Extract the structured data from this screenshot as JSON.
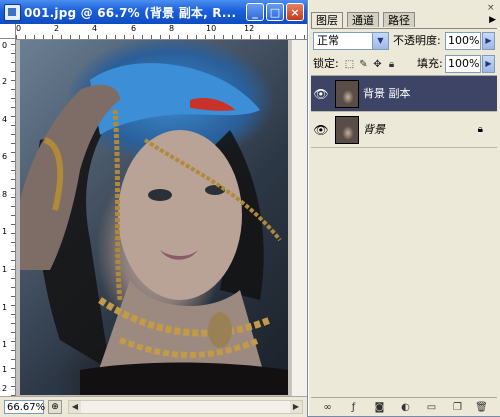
{
  "document": {
    "title": "001.jpg @ 66.7% (背景 副本, R...",
    "window_buttons": {
      "minimize": "_",
      "maximize": "□",
      "close": "×"
    },
    "ruler_top_labels": [
      "0",
      "2",
      "4",
      "6",
      "8",
      "10",
      "12"
    ],
    "ruler_left_labels": [
      "0",
      "2",
      "4",
      "6",
      "8",
      "1",
      "1",
      "1",
      "1",
      "1",
      "2"
    ],
    "zoom": "66.67%",
    "status_icon": "⊕",
    "image_description_icon": "portrait-photo"
  },
  "layers_panel": {
    "close": "×",
    "tabs": [
      "图层",
      "通道",
      "路径"
    ],
    "active_tab": 0,
    "menu_arrow": "▶",
    "blend_mode": "正常",
    "opacity_label": "不透明度:",
    "opacity_value": "100%",
    "lock_label": "锁定:",
    "fill_label": "填充:",
    "fill_value": "100%",
    "arrow": "▶",
    "dropdown_arrow": "▼",
    "layers": [
      {
        "name": "背景 副本",
        "selected": true,
        "italic": false,
        "locked": false
      },
      {
        "name": "背景",
        "selected": false,
        "italic": true,
        "locked": true
      }
    ],
    "bottom_icons": [
      "link-icon",
      "fx-icon",
      "mask-icon",
      "adjustment-icon",
      "folder-icon",
      "new-layer-icon",
      "trash-icon"
    ]
  },
  "colors": {
    "titlebar": "#1b5fd9",
    "panel_bg": "#ece9d8",
    "selected_layer": "#3d4466"
  }
}
